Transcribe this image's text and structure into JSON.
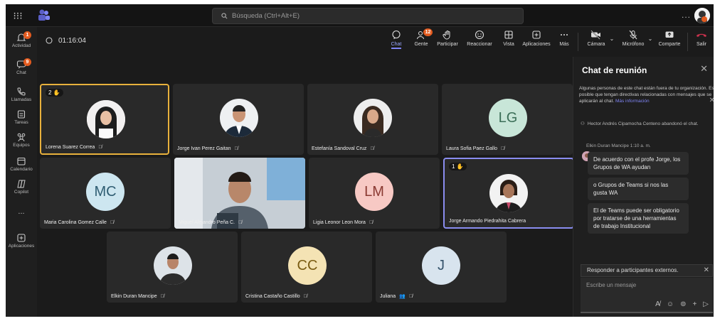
{
  "topbar": {
    "search_placeholder": "Búsqueda (Ctrl+Alt+E)",
    "more": "..."
  },
  "rail": {
    "items": [
      {
        "label": "Actividad",
        "icon": "bell-icon",
        "badge": "1"
      },
      {
        "label": "Chat",
        "icon": "chat-icon",
        "badge": "9"
      },
      {
        "label": "Llamadas",
        "icon": "phone-icon"
      },
      {
        "label": "Tareas",
        "icon": "tasks-icon"
      },
      {
        "label": "Equipos",
        "icon": "teams-icon"
      },
      {
        "label": "Calendario",
        "icon": "calendar-icon"
      },
      {
        "label": "Copilot",
        "icon": "copilot-icon"
      },
      {
        "label": "...",
        "icon": "more-icon"
      },
      {
        "label": "Aplicaciones",
        "icon": "apps-icon"
      }
    ]
  },
  "meeting": {
    "timer": "01:16:04",
    "buttons": [
      {
        "label": "Chat",
        "icon": "chat-icon"
      },
      {
        "label": "Gente",
        "icon": "people-icon",
        "badge": "12"
      },
      {
        "label": "Participar",
        "icon": "hand-icon"
      },
      {
        "label": "Reaccionar",
        "icon": "smile-icon"
      },
      {
        "label": "Vista",
        "icon": "grid-icon"
      },
      {
        "label": "Aplicaciones",
        "icon": "plus-icon"
      },
      {
        "label": "Más",
        "icon": "more-icon"
      },
      {
        "label": "Cámara",
        "icon": "camera-off-icon"
      },
      {
        "label": "Micrófono",
        "icon": "mic-off-icon"
      },
      {
        "label": "Comparte",
        "icon": "share-icon"
      },
      {
        "label": "Salir",
        "icon": "hangup-icon"
      }
    ]
  },
  "participants": [
    {
      "name": "Lorena Suarez Correa",
      "hand": "2",
      "type": "photo"
    },
    {
      "name": "Jorge Ivan Perez Gaitan",
      "type": "photo"
    },
    {
      "name": "Estefanía Sandoval Cruz",
      "type": "photo"
    },
    {
      "name": "Laura Sofia Paez Gallo",
      "initials": "LG",
      "color": "#c8e6d8"
    },
    {
      "name": "Maria Carolina Gomez Calle",
      "initials": "MC",
      "color": "#cde6f0"
    },
    {
      "name": "Miguel Alejandro Peña C.",
      "type": "video"
    },
    {
      "name": "Ligia Leonor Leon Mora",
      "initials": "LM",
      "color": "#f7c9c4"
    },
    {
      "name": "Jorge Armando Piedrahita Cabrera",
      "hand": "1",
      "type": "photo"
    },
    {
      "name": "Elkin Duran Mancipe",
      "type": "photo"
    },
    {
      "name": "Cristina Castaño Castillo",
      "initials": "CC",
      "color": "#f4e3b4"
    },
    {
      "name": "Juliana",
      "initials": "J",
      "color": "#d8e4ee"
    }
  ],
  "chat": {
    "title": "Chat de reunión",
    "notice": "Algunas personas de este chat están fuera de tu organización. Es posible que tengan directivas relacionadas con mensajes que se aplicarán al chat.",
    "notice_link": "Más información",
    "system": "Hector Andrés Cipamocha Centeno abandonó el chat.",
    "sender": "Elkin Duran Mancipe  1:10 a. m.",
    "messages": [
      "De acuerdo con el profe Jorge, los Grupos de WA ayudan",
      "o Grupos de Teams si nos las gusta WA",
      "El de Teams puede ser obligatorio por tratarse de una herramientas de trabajo Institucional"
    ],
    "reply_label": "Responder a participantes externos.",
    "compose_placeholder": "Escribe un mensaje"
  },
  "colors": {
    "accent": "#7f85f5",
    "leave": "#c4314b",
    "highlight": "#e8b13c"
  }
}
